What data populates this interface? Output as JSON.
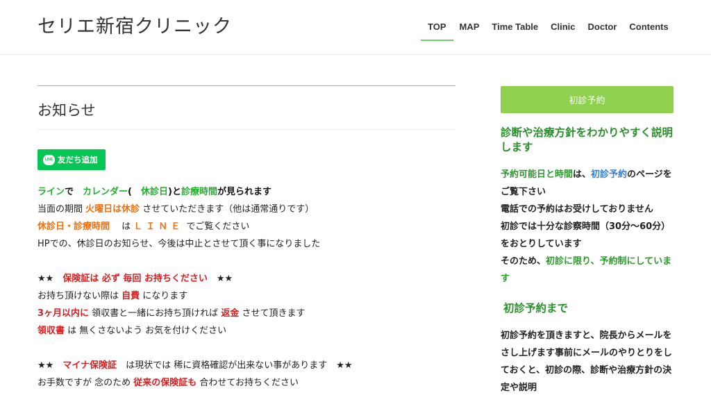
{
  "site": {
    "title": "セリエ新宿クリニック"
  },
  "nav": [
    "TOP",
    "MAP",
    "Time Table",
    "Clinic",
    "Doctor",
    "Contents"
  ],
  "main": {
    "heading": "お知らせ",
    "line_button": {
      "icon": "LINE",
      "label": "友だち追加"
    },
    "notice": {
      "l1": {
        "a": "ライン",
        "b": "で　",
        "c": "カレンダー",
        "d": "(　",
        "e": "休診日",
        "f": ")と",
        "g": "診療時間",
        "h": "が見られます"
      },
      "l2": {
        "a": "当面の期間 ",
        "b": "火曜日は休診",
        "c": " させていただきます（他は通常通りです）"
      },
      "l3": {
        "a": "休診日・診療時間",
        "b": "　 は ",
        "c": "ＬＩＮＥ",
        "d": " でご覧ください"
      },
      "l4": "HPでの、休診日のお知らせ、今後は中止とさせて頂く事になりました",
      "l5": {
        "a": "★★　",
        "b": "保険証は 必ず 毎回 お持ちください",
        "c": "　★★"
      },
      "l6": {
        "a": "お持ち頂けない際は ",
        "b": "自費",
        "c": " になります"
      },
      "l7": {
        "a": "3ヶ月以内に",
        "b": " 領収書と一緒にお持ち頂ければ ",
        "c": "返金",
        "d": " させて頂きます"
      },
      "l8": {
        "a": "領収書",
        "b": " は 無くさないよう お気を付けください"
      },
      "l9": {
        "a": "★★　",
        "b": "マイナ保険証",
        "c": "　は現状では 稀に資格確認が出来ない事があります　★★"
      },
      "l10": {
        "a": "お手数ですが 念のため ",
        "b": "従来の保険証も",
        "c": " 合わせてお持ちください"
      }
    }
  },
  "sidebar": {
    "reserve_button": "初診予約",
    "heading1": "診断や治療方針をわかりやすく説明します",
    "text1": {
      "a": "予約可能日と時間",
      "b": "は、",
      "c": "初診予約",
      "d": "のページをご覧下さい",
      "e": "電話での予約はお受けしておりません",
      "f": "初診では十分な診察時間（30分～60分）をおとりしています",
      "g": "そのため、",
      "h": "初診に限り、予約制にしています"
    },
    "heading2": "初診予約まで",
    "text2": "初診予約を頂きますと、院長からメールをさし上げます事前にメールのやりとりをしておくと、初診の際、診断や治療方針の決定や説明"
  }
}
